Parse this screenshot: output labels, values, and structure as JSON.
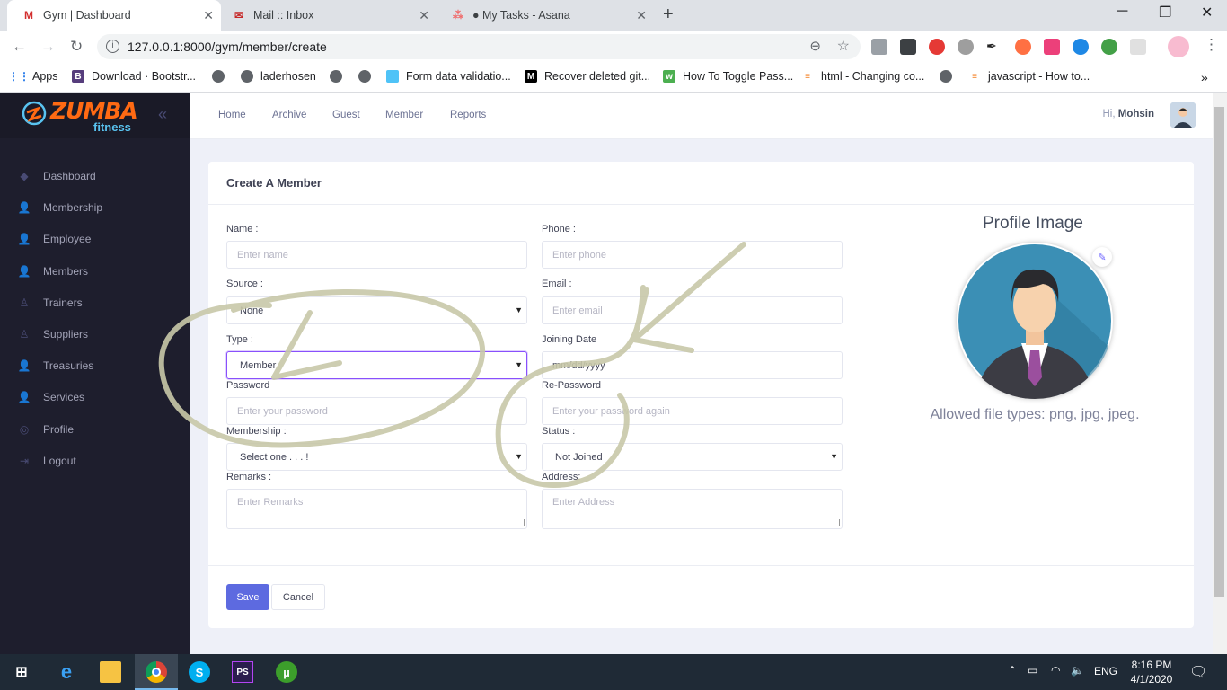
{
  "browser": {
    "tabs": [
      {
        "title": "Gym | Dashboard",
        "icon": "m-logo-icon",
        "active": true
      },
      {
        "title": "Mail :: Inbox",
        "icon": "mail-icon",
        "active": false
      },
      {
        "title": "● My Tasks - Asana",
        "icon": "asana-icon",
        "active": false
      }
    ],
    "url": "127.0.0.1:8000/gym/member/create",
    "bookmarks": [
      {
        "label": "Apps",
        "icon": "apps-grid-icon"
      },
      {
        "label": "Download · Bootstr...",
        "icon": "bootstrap-icon"
      },
      {
        "label": "",
        "icon": "globe-icon"
      },
      {
        "label": "laderhosen",
        "icon": "globe-icon"
      },
      {
        "label": "",
        "icon": "globe-icon"
      },
      {
        "label": "",
        "icon": "globe-icon"
      },
      {
        "label": "Form data validatio...",
        "icon": "bookmark-icon"
      },
      {
        "label": "Recover deleted git...",
        "icon": "medium-icon"
      },
      {
        "label": "How To Toggle Pass...",
        "icon": "w3-icon"
      },
      {
        "label": "html - Changing co...",
        "icon": "stackoverflow-icon"
      },
      {
        "label": "",
        "icon": "globe-icon"
      },
      {
        "label": "javascript - How to...",
        "icon": "stackoverflow-icon"
      }
    ]
  },
  "brand": {
    "name": "ZUMBA",
    "sub": "fitness"
  },
  "sidebar": {
    "items": [
      {
        "label": "Dashboard",
        "icon": "diamond-icon"
      },
      {
        "label": "Membership",
        "icon": "users-icon"
      },
      {
        "label": "Employee",
        "icon": "users-icon"
      },
      {
        "label": "Members",
        "icon": "users-icon"
      },
      {
        "label": "Trainers",
        "icon": "user-icon"
      },
      {
        "label": "Suppliers",
        "icon": "user-icon"
      },
      {
        "label": "Treasuries",
        "icon": "users-icon"
      },
      {
        "label": "Services",
        "icon": "users-icon"
      },
      {
        "label": "Profile",
        "icon": "circle-user-icon"
      },
      {
        "label": "Logout",
        "icon": "logout-icon"
      }
    ]
  },
  "topnav": {
    "links": [
      "Home",
      "Archive",
      "Guest",
      "Member",
      "Reports"
    ],
    "greeting": "Hi,",
    "user": "Mohsin"
  },
  "form": {
    "title": "Create A Member",
    "name_label": "Name :",
    "name_placeholder": "Enter name",
    "phone_label": "Phone :",
    "phone_placeholder": "Enter phone",
    "source_label": "Source :",
    "source_value": "None",
    "email_label": "Email :",
    "email_placeholder": "Enter email",
    "type_label": "Type :",
    "type_value": "Member",
    "joining_label": "Joining Date",
    "joining_placeholder": "mm/dd/yyyy",
    "password_label": "Password",
    "password_placeholder": "Enter your password",
    "repassword_label": "Re-Password",
    "repassword_placeholder": "Enter your password again",
    "membership_label": "Membership :",
    "membership_value": "Select one . . . !",
    "status_label": "Status :",
    "status_value": "Not Joined",
    "remarks_label": "Remarks :",
    "remarks_placeholder": "Enter Remarks",
    "address_label": "Address:",
    "address_placeholder": "Enter Address",
    "save_label": "Save",
    "cancel_label": "Cancel"
  },
  "profile": {
    "title": "Profile Image",
    "hint": "Allowed file types: png, jpg, jpeg."
  },
  "taskbar": {
    "time": "8:16 PM",
    "date": "4/1/2020",
    "lang": "ENG"
  },
  "colors": {
    "sidebar": "#1e1e2d",
    "primary": "#5d6ae0",
    "annotation": "#c8c8a9",
    "brand_orange": "#ff6a13"
  }
}
